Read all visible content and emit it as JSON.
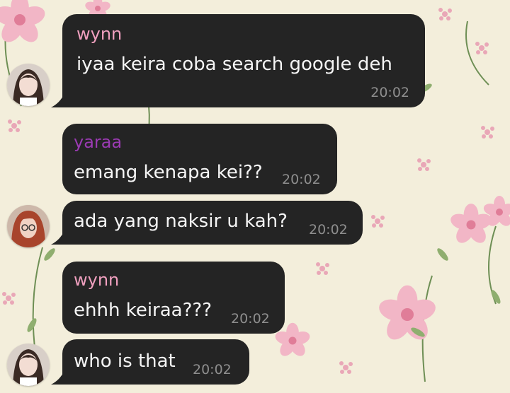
{
  "chat": {
    "colors": {
      "wallpaper": "#f3eedb",
      "bubble": "#242424",
      "message_text": "#f5f5f5",
      "timestamp": "#8e8e8e",
      "sender_wynn": "#f0a0bf",
      "sender_yaraa": "#9b3bb3"
    },
    "wallpaper_pattern": "pink-flowers-and-green-leaves",
    "messages": [
      {
        "sender": "wynn",
        "text": "iyaa keira coba search google deh",
        "time": "20:02",
        "avatar": "wynn-avatar"
      },
      {
        "sender": "yaraa",
        "text": "emang kenapa kei??",
        "time": "20:02"
      },
      {
        "text": "ada yang naksir u kah?",
        "time": "20:02",
        "avatar": "yaraa-avatar"
      },
      {
        "sender": "wynn",
        "text": "ehhh keiraa???",
        "time": "20:02"
      },
      {
        "text": "who is that",
        "time": "20:02",
        "avatar": "wynn-avatar"
      }
    ]
  }
}
